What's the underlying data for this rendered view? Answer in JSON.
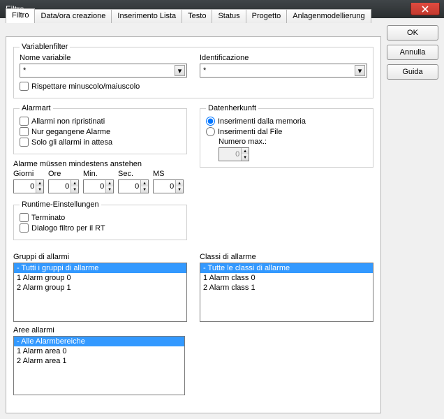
{
  "window": {
    "title": "Filtro"
  },
  "buttons": {
    "ok": "OK",
    "cancel": "Annulla",
    "help": "Guida"
  },
  "tabs": [
    "Filtro",
    "Data/ora creazione",
    "Inserimento Lista",
    "Testo",
    "Status",
    "Progetto",
    "Anlagenmodellierung"
  ],
  "variablenfilter": {
    "legend": "Variablenfilter",
    "name_label": "Nome variabile",
    "name_value": "*",
    "ident_label": "Identificazione",
    "ident_value": "*",
    "case_label": "Rispettare minuscolo/maiuscolo"
  },
  "alarmart": {
    "legend": "Alarmart",
    "opt1": "Allarmi non ripristinati",
    "opt2": "Nur gegangene Alarme",
    "opt3": "Solo gli allarmi in attesa"
  },
  "minalarm": {
    "label": "Alarme müssen mindestens anstehen",
    "cols": {
      "giorni": "Giorni",
      "ore": "Ore",
      "min": "Min.",
      "sec": "Sec.",
      "ms": "MS"
    },
    "vals": {
      "giorni": "0",
      "ore": "0",
      "min": "0",
      "sec": "0",
      "ms": "0"
    }
  },
  "datenherkunft": {
    "legend": "Datenherkunft",
    "opt1": "Inserimenti dalla memoria",
    "opt2": "Inserimenti dal File",
    "max_label": "Numero max.:",
    "max_value": "0"
  },
  "runtime": {
    "legend": "Runtime-Einstellungen",
    "opt1": "Terminato",
    "opt2": "Dialogo filtro per il RT"
  },
  "groups": {
    "title": "Gruppi di allarmi",
    "items": [
      "- Tutti i gruppi di allarme",
      "1 Alarm group 0",
      "2 Alarm group 1"
    ]
  },
  "classes": {
    "title": "Classi di allarme",
    "items": [
      "- Tutte le classi di allarme",
      "1 Alarm class 0",
      "2 Alarm class 1"
    ]
  },
  "aree": {
    "title": "Aree allarmi",
    "items": [
      "- Alle Alarmbereiche",
      "1 Alarm area 0",
      "2 Alarm area 1"
    ]
  }
}
